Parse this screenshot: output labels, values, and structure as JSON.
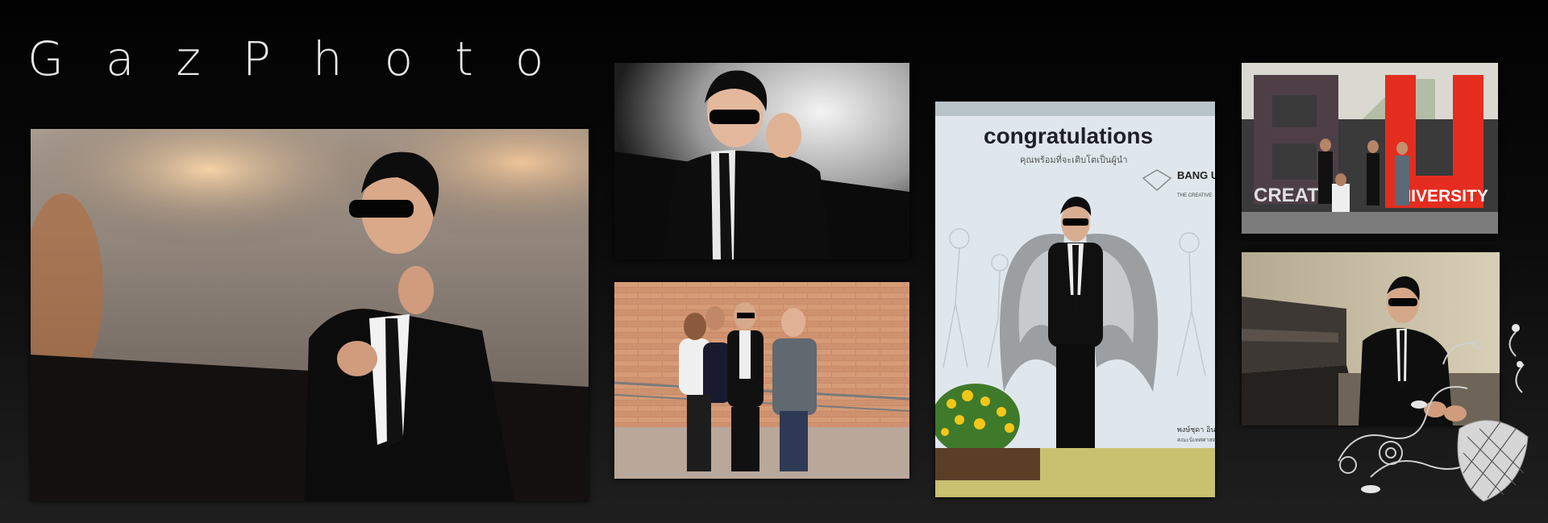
{
  "brand": {
    "title": "GazPhoto"
  },
  "photos": {
    "congrats_banner": {
      "headline": "congratulations",
      "subline": "คุณพร้อมที่จะเติบโตเป็นผู้นำ",
      "logo_text": "BANG UNIVE",
      "logo_sub": "THE CREATIVE",
      "footer_text": "พงษ์ชุดา อิน",
      "footer_sub": "คณะนิเทศศาสตร์"
    },
    "campus_sign": {
      "left_word": "CREAT",
      "right_word": "NIVERSITY"
    }
  }
}
